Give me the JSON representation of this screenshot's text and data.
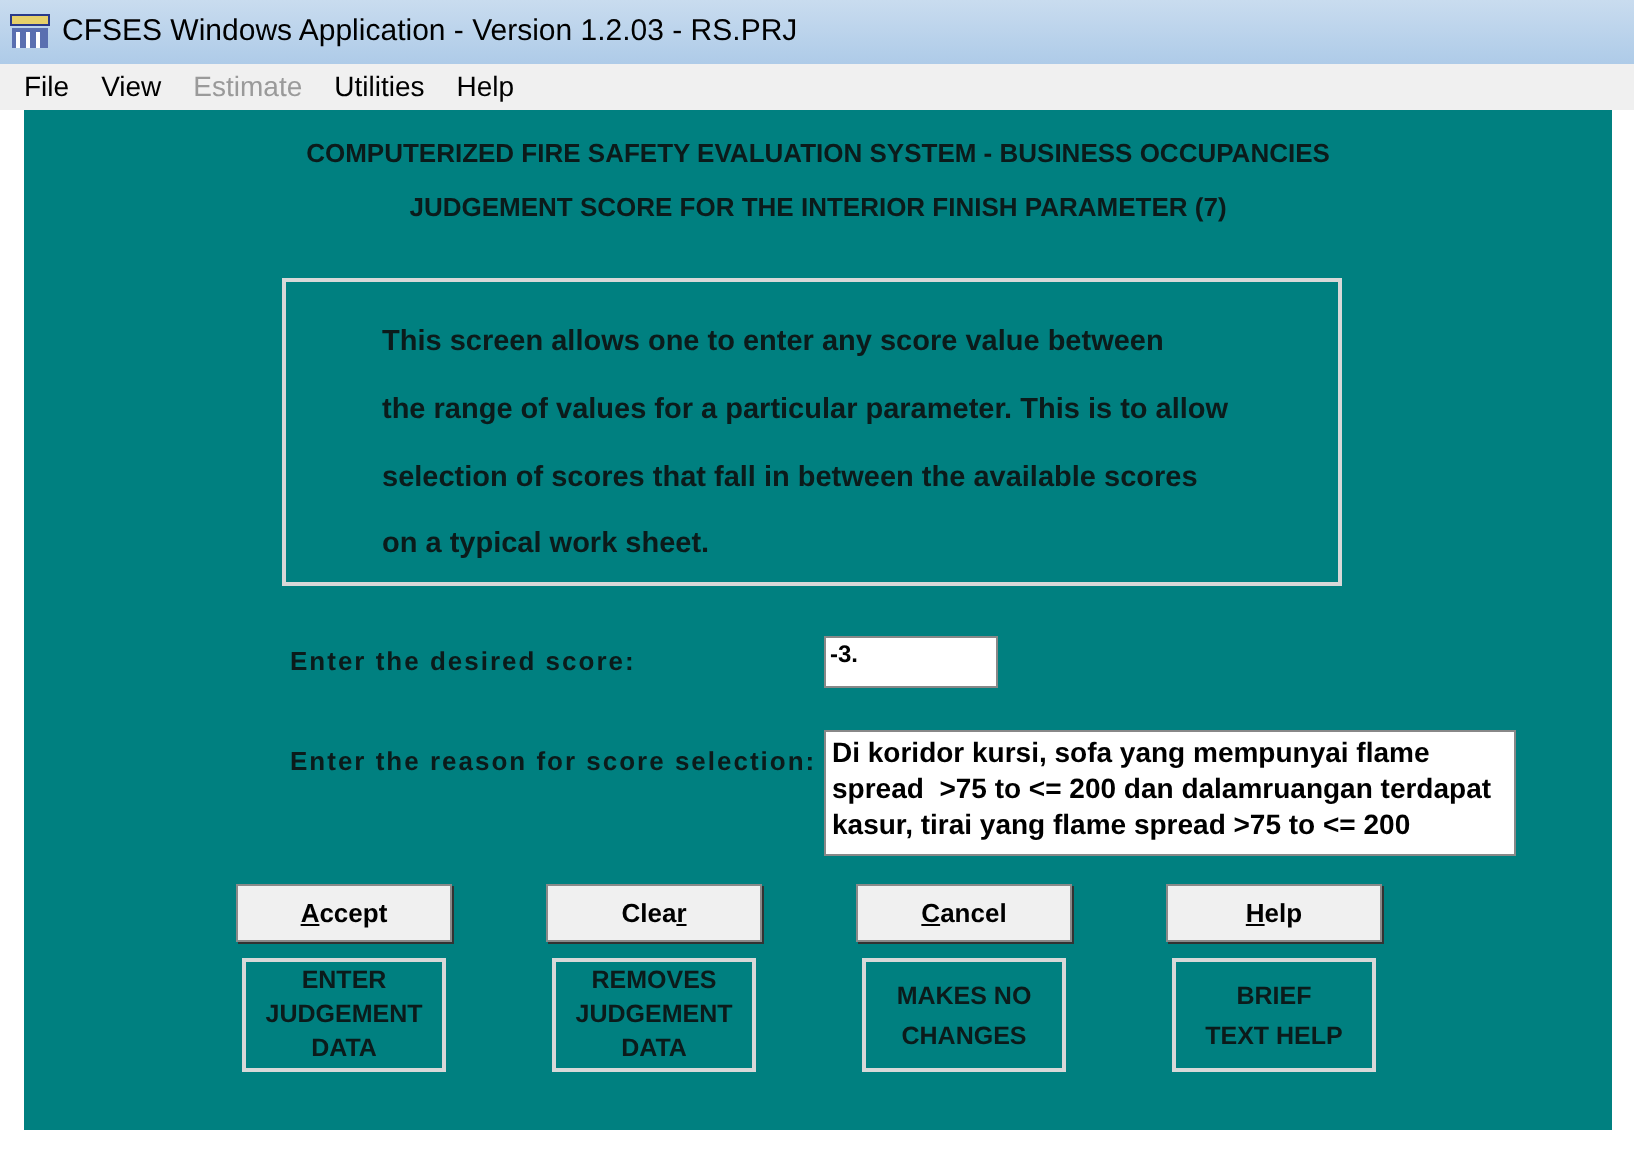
{
  "window": {
    "title": "CFSES Windows Application - Version 1.2.03 - RS.PRJ"
  },
  "menu": [
    {
      "label": "File",
      "disabled": false
    },
    {
      "label": "View",
      "disabled": false
    },
    {
      "label": "Estimate",
      "disabled": true
    },
    {
      "label": "Utilities",
      "disabled": false
    },
    {
      "label": "Help",
      "disabled": false
    }
  ],
  "headings": [
    "COMPUTERIZED FIRE SAFETY EVALUATION SYSTEM - BUSINESS OCCUPANCIES",
    "JUDGEMENT SCORE FOR THE INTERIOR FINISH PARAMETER (7)"
  ],
  "info_lines": [
    "This screen allows one to enter any score value between",
    "the range of values for a particular parameter.  This is to allow",
    "selection of scores that fall in between the available scores",
    "on a typical work sheet."
  ],
  "score": {
    "label": "Enter the desired score:",
    "value": "-3."
  },
  "reason": {
    "label": "Enter the reason for score selection:",
    "value": "Di koridor kursi, sofa yang mempunyai flame spread  >75 to <= 200 dan dalamruangan terdapat kasur, tirai yang flame spread >75 to <= 200"
  },
  "buttons": [
    {
      "key": "A",
      "after": "ccept",
      "description": [
        "ENTER",
        "JUDGEMENT",
        "DATA"
      ]
    },
    {
      "before": "Clea",
      "key": "r",
      "description": [
        "REMOVES",
        "JUDGEMENT",
        "DATA"
      ]
    },
    {
      "key": "C",
      "after": "ancel",
      "description": [
        "MAKES NO",
        "CHANGES"
      ]
    },
    {
      "key": "H",
      "after": "elp",
      "description": [
        "BRIEF",
        "TEXT HELP"
      ]
    }
  ]
}
